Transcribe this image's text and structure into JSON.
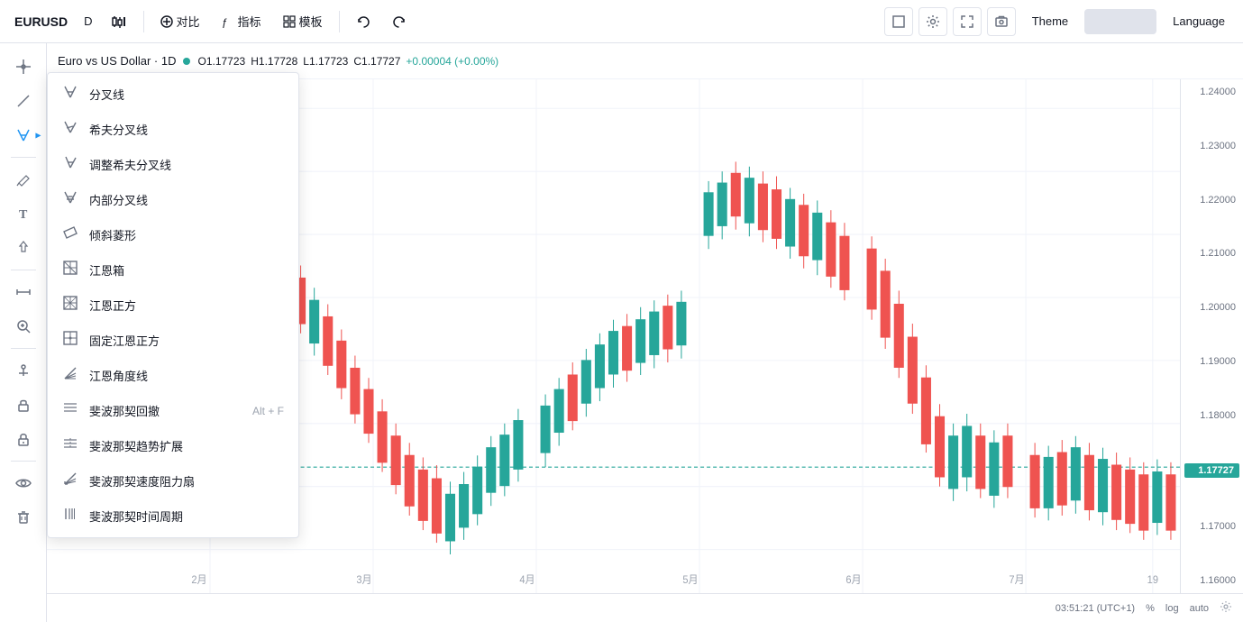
{
  "toolbar": {
    "symbol": "EURUSD",
    "interval": "D",
    "compare_btn": "对比",
    "indicators_btn": "指标",
    "templates_btn": "模板",
    "undo_icon": "↩",
    "redo_icon": "↪",
    "theme_label": "Theme",
    "language_label": "Language"
  },
  "chart_header": {
    "symbol_name": "Euro vs US Dollar · 1D",
    "o_label": "O",
    "o_value": "1.17723",
    "h_label": "H",
    "h_value": "1.17728",
    "l_label": "L",
    "l_value": "1.17723",
    "c_label": "C",
    "c_value": "1.17727",
    "change": "+0.00004 (+0.00%)"
  },
  "price_axis": {
    "labels": [
      "1.24000",
      "1.23000",
      "1.22000",
      "1.21000",
      "1.20000",
      "1.19000",
      "1.18000",
      "1.17000",
      "1.16000"
    ],
    "current_price": "1.17727"
  },
  "time_axis": {
    "labels": [
      "2月",
      "3月",
      "4月",
      "5月",
      "6月",
      "7月",
      "19"
    ]
  },
  "bottom_bar": {
    "time": "03:51:21 (UTC+1)",
    "percent": "%",
    "log": "log",
    "auto": "auto"
  },
  "dropdown_menu": {
    "items": [
      {
        "id": "fork-lines",
        "icon": "⋇",
        "label": "分叉线",
        "shortcut": ""
      },
      {
        "id": "schiff-fork",
        "icon": "⋇",
        "label": "希夫分叉线",
        "shortcut": ""
      },
      {
        "id": "modified-schiff",
        "icon": "⋇",
        "label": "调整希夫分叉线",
        "shortcut": ""
      },
      {
        "id": "inner-fork",
        "icon": "⋇",
        "label": "内部分叉线",
        "shortcut": ""
      },
      {
        "id": "tilted-parallelogram",
        "icon": "▦",
        "label": "倾斜菱形",
        "shortcut": ""
      },
      {
        "id": "gann-box",
        "icon": "▦",
        "label": "江恩箱",
        "shortcut": ""
      },
      {
        "id": "gann-square",
        "icon": "▦",
        "label": "江恩正方",
        "shortcut": ""
      },
      {
        "id": "gann-fixed-square",
        "icon": "▦",
        "label": "固定江恩正方",
        "shortcut": ""
      },
      {
        "id": "gann-angles",
        "icon": "⋇",
        "label": "江恩角度线",
        "shortcut": ""
      },
      {
        "id": "fib-retracement",
        "icon": "≡",
        "label": "斐波那契回撤",
        "shortcut": "Alt + F"
      },
      {
        "id": "fib-extension",
        "icon": "≡",
        "label": "斐波那契趋势扩展",
        "shortcut": ""
      },
      {
        "id": "fib-speed",
        "icon": "⋇",
        "label": "斐波那契速度阻力扇",
        "shortcut": ""
      },
      {
        "id": "fib-time",
        "icon": "|||",
        "label": "斐波那契时间周期",
        "shortcut": ""
      }
    ]
  },
  "sidebar_tools": [
    {
      "id": "crosshair",
      "icon": "✛"
    },
    {
      "id": "line",
      "icon": "╱"
    },
    {
      "id": "fork-active",
      "icon": "⋇",
      "active": true
    },
    {
      "id": "pencil",
      "icon": "✏"
    },
    {
      "id": "text",
      "icon": "T"
    },
    {
      "id": "patterns",
      "icon": "⊕"
    },
    {
      "id": "measure",
      "icon": "↔"
    },
    {
      "id": "zoom",
      "icon": "⊕"
    },
    {
      "id": "anchor",
      "icon": "⚓"
    },
    {
      "id": "lock",
      "icon": "🔒"
    },
    {
      "id": "eye",
      "icon": "👁"
    },
    {
      "id": "trash",
      "icon": "🗑"
    }
  ]
}
